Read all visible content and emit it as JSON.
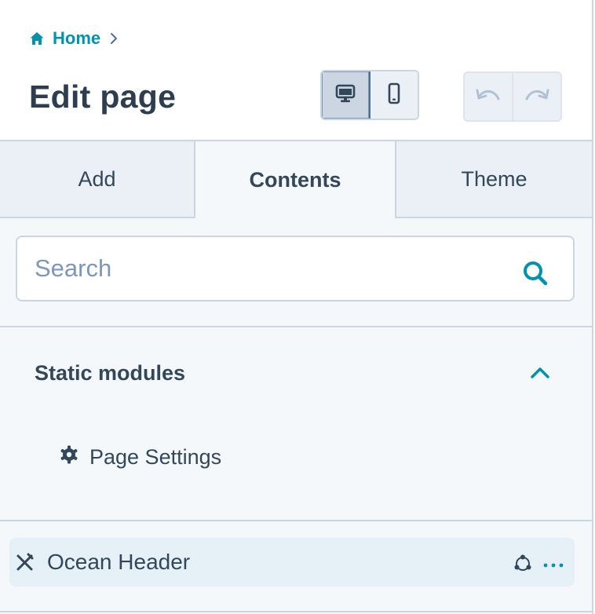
{
  "header": {
    "breadcrumb": {
      "label": "Home",
      "icon": "home-icon",
      "separator_icon": "chevron-right-icon"
    },
    "title": "Edit page",
    "device_toggle": [
      {
        "name": "desktop",
        "icon": "desktop-icon",
        "active": true
      },
      {
        "name": "mobile",
        "icon": "mobile-icon",
        "active": false
      }
    ],
    "history": [
      {
        "name": "undo",
        "icon": "undo-icon",
        "enabled": false
      },
      {
        "name": "redo",
        "icon": "redo-icon",
        "enabled": false
      }
    ]
  },
  "tabs": [
    {
      "label": "Add",
      "active": false
    },
    {
      "label": "Contents",
      "active": true
    },
    {
      "label": "Theme",
      "active": false
    }
  ],
  "search": {
    "placeholder": "Search",
    "value": ""
  },
  "sections": [
    {
      "title": "Static modules",
      "expanded": true,
      "items": [
        {
          "label": "Page Settings",
          "icon": "gear-icon"
        }
      ]
    }
  ],
  "modules": [
    {
      "label": "Ocean Header",
      "icons": [
        "drag-icon",
        "global-icon",
        "more-icon"
      ]
    }
  ],
  "colors": {
    "accent": "#0091ae",
    "text": "#33475b",
    "panel_bg": "#f5f8fa",
    "tab_bg": "#eaf0f6",
    "border": "#cbd6e2",
    "module_highlight": "#e5f0f7"
  }
}
